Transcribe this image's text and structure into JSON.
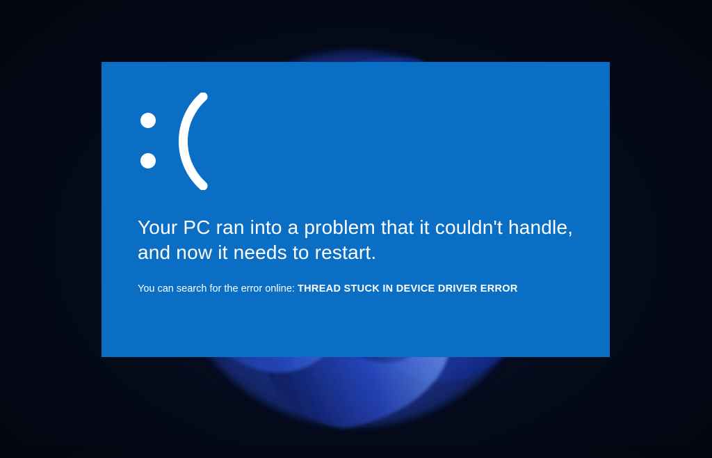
{
  "bsod": {
    "emoticon": ":(",
    "message": "Your PC ran into a problem that it couldn't handle, and now it needs to restart.",
    "search_prefix": "You can search for the error online: ",
    "error_code": "THREAD STUCK IN DEVICE DRIVER ERROR"
  },
  "colors": {
    "bsod_bg": "#0b6ec5",
    "bsod_fg": "#ffffff",
    "desktop_dark": "#040815"
  }
}
